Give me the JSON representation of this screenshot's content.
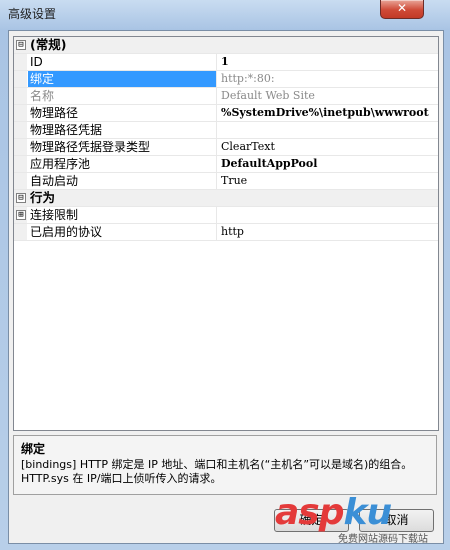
{
  "window": {
    "title": "高级设置",
    "close_label": "✕"
  },
  "grid": {
    "rows": [
      {
        "type": "category",
        "toggle": "⊟",
        "label": "(常规)"
      },
      {
        "type": "prop",
        "name": "ID",
        "value": "1",
        "style": "bold"
      },
      {
        "type": "prop",
        "name": "绑定",
        "value": "http:*:80:",
        "style": "disabled",
        "selected": true
      },
      {
        "type": "prop",
        "name": "名称",
        "value": "Default Web Site",
        "style": "disabled"
      },
      {
        "type": "prop",
        "name": "物理路径",
        "value": "%SystemDrive%\\inetpub\\wwwroot",
        "style": "bold"
      },
      {
        "type": "prop",
        "name": "物理路径凭据",
        "value": ""
      },
      {
        "type": "prop",
        "name": "物理路径凭据登录类型",
        "value": "ClearText"
      },
      {
        "type": "prop",
        "name": "应用程序池",
        "value": "DefaultAppPool",
        "style": "bold"
      },
      {
        "type": "prop",
        "name": "自动启动",
        "value": "True"
      },
      {
        "type": "category",
        "toggle": "⊟",
        "label": "行为"
      },
      {
        "type": "prop",
        "name": "连接限制",
        "value": "",
        "expander": "⊞"
      },
      {
        "type": "prop",
        "name": "已启用的协议",
        "value": "http"
      }
    ]
  },
  "description": {
    "title": "绑定",
    "text": "[bindings] HTTP 绑定是 IP 地址、端口和主机名(“主机名”可以是域名)的组合。HTTP.sys 在 IP/端口上侦听传入的请求。"
  },
  "buttons": {
    "ok": "确定",
    "cancel": "取消"
  },
  "watermark": {
    "asp": "asp",
    "ku": "ku",
    "tld": ".com",
    "sub": "免费网站源码下载站"
  }
}
